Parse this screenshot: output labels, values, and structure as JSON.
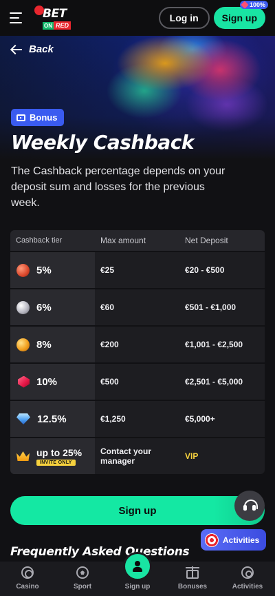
{
  "header": {
    "logo": {
      "bet": "BET",
      "on": "ON",
      "red": "RED"
    },
    "login_label": "Log in",
    "signup_label": "Sign up",
    "signup_badge": "100%"
  },
  "hero": {
    "back_label": "Back",
    "tag_label": "Bonus",
    "title": "Weekly Cashback",
    "description": "The Cashback percentage depends on your deposit sum and losses for the previous week."
  },
  "table": {
    "headers": [
      "Cashback tier",
      "Max amount",
      "Net Deposit"
    ],
    "rows": [
      {
        "icon": "bronze-coin-icon",
        "tier": "5%",
        "max": "€25",
        "net": "€20 - €500"
      },
      {
        "icon": "silver-coin-icon",
        "tier": "6%",
        "max": "€60",
        "net": "€501 - €1,000"
      },
      {
        "icon": "gold-coin-icon",
        "tier": "8%",
        "max": "€200",
        "net": "€1,001 - €2,500"
      },
      {
        "icon": "ruby-icon",
        "tier": "10%",
        "max": "€500",
        "net": "€2,501 - €5,000"
      },
      {
        "icon": "diamond-icon",
        "tier": "12.5%",
        "max": "€1,250",
        "net": "€5,000+"
      },
      {
        "icon": "crown-icon",
        "tier": "up to 25%",
        "tier_badge": "INVITE ONLY",
        "max": "Contact your manager",
        "net": "VIP"
      }
    ]
  },
  "signup_button_label": "Sign up",
  "activities_label": "Activities",
  "faq_title": "Frequently Asked Questions",
  "bottom_nav": {
    "items": [
      {
        "label": "Casino",
        "icon": "casino-chip-icon"
      },
      {
        "label": "Sport",
        "icon": "soccer-ball-icon"
      },
      {
        "label": "Sign up",
        "icon": "user-icon"
      },
      {
        "label": "Bonuses",
        "icon": "gift-icon"
      },
      {
        "label": "Activities",
        "icon": "activities-icon"
      }
    ]
  },
  "colors": {
    "accent_green": "#19e4a3",
    "brand_red": "#e8262e",
    "bonus_blue": "#3a5bf0",
    "vip_yellow": "#f7d23e"
  }
}
